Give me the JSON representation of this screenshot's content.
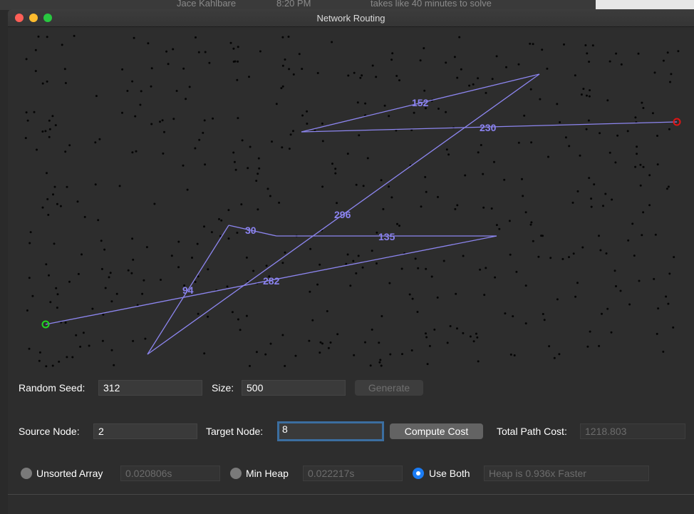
{
  "background": {
    "name": "Jace Kahlbare",
    "time": "8:20 PM",
    "message": "takes like 40 minutes to solve"
  },
  "window": {
    "title": "Network Routing"
  },
  "colors": {
    "path": "#8d86f0",
    "label": "#8a82ee",
    "node": "#050505",
    "source": "#22d622",
    "target": "#e01414"
  },
  "graph": {
    "path_labels": [
      "152",
      "230",
      "296",
      "30",
      "135",
      "94",
      "282"
    ]
  },
  "controls": {
    "random_seed_label": "Random Seed:",
    "random_seed_value": "312",
    "size_label": "Size:",
    "size_value": "500",
    "generate_label": "Generate",
    "source_label": "Source Node:",
    "source_value": "2",
    "target_label": "Target Node:",
    "target_value": "8",
    "compute_label": "Compute Cost",
    "total_label": "Total Path Cost:",
    "total_value": "1218.803"
  },
  "modes": {
    "unsorted_label": "Unsorted Array",
    "unsorted_time": "0.020806s",
    "heap_label": "Min Heap",
    "heap_time": "0.022217s",
    "both_label": "Use Both",
    "both_result": "Heap is 0.936x Faster",
    "selected": "both"
  }
}
